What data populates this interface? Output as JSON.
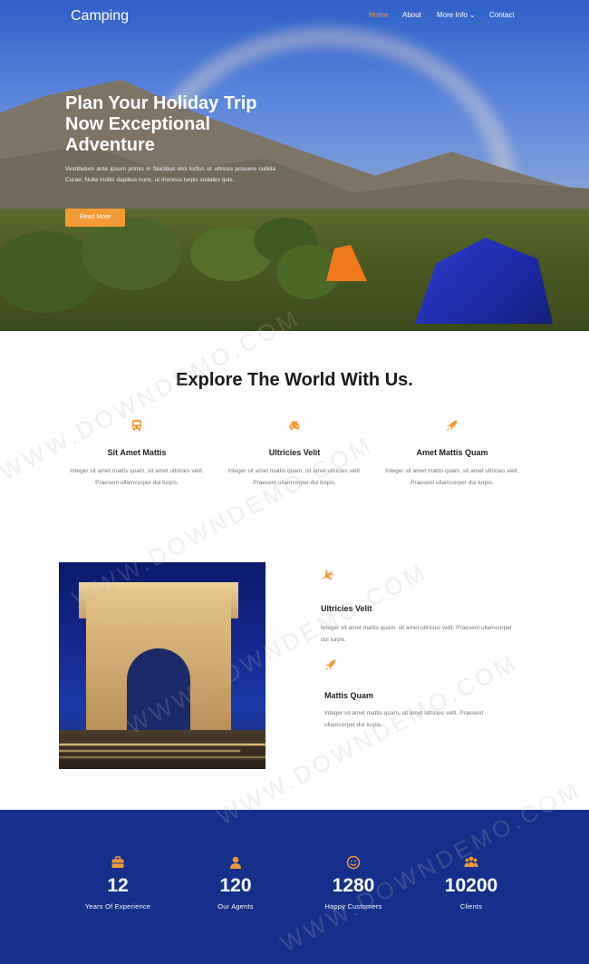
{
  "nav": {
    "logo": "Camping",
    "links": [
      {
        "label": "Home",
        "active": true
      },
      {
        "label": "About",
        "active": false
      },
      {
        "label": "More Info",
        "active": false
      },
      {
        "label": "Contact",
        "active": false
      }
    ],
    "dropdown_glyph": "⌄"
  },
  "hero": {
    "title": "Plan Your Holiday Trip Now Exceptional Adventure",
    "text": "Vestibulum ante ipsum primis in faucibus orci luctus et ultrices posuere cubilia Curae; Nulla mollis dapibus nunc, ut rhoncus turpis sodales quis.",
    "button_label": "Read More"
  },
  "explore": {
    "title": "Explore The World With Us.",
    "features": [
      {
        "icon": "bus-icon",
        "title": "Sit Amet Mattis",
        "text": "Integer sit amet mattis quam, sit amet ultricies velit. Praesent ullamcorper dui turpis."
      },
      {
        "icon": "car-icon",
        "title": "Ultricies Velit",
        "text": "Integer sit amet mattis quam, sit amet ultricies velit. Praesent ullamcorper dui turpis."
      },
      {
        "icon": "rocket-icon",
        "title": "Amet Mattis Quam",
        "text": "Integer sit amet mattis quam, sit amet ultricies velit. Praesent ullamcorper dui turpis."
      }
    ]
  },
  "about": {
    "items": [
      {
        "icon": "plane-icon",
        "title": "Ultricies Velit",
        "text": "Integer sit amet mattis quam, sit amet ultricies velit. Praesent ullamcorper dui turpis."
      },
      {
        "icon": "rocket-icon",
        "title": "Mattis Quam",
        "text": "Integer sit amet mattis quam, sit amet ultricies velit. Praesent ullamcorper dui turpis."
      }
    ]
  },
  "stats": [
    {
      "icon": "briefcase-icon",
      "value": "12",
      "label": "Years Of Experience"
    },
    {
      "icon": "user-icon",
      "value": "120",
      "label": "Our Agents"
    },
    {
      "icon": "smile-icon",
      "value": "1280",
      "label": "Happy Customers"
    },
    {
      "icon": "users-icon",
      "value": "10200",
      "label": "Clients"
    }
  ],
  "watermark": "WWW.DOWNDEMO.COM",
  "colors": {
    "accent": "#f39a35",
    "stats_bg": "#15308a",
    "heading": "#1a1a1a"
  }
}
